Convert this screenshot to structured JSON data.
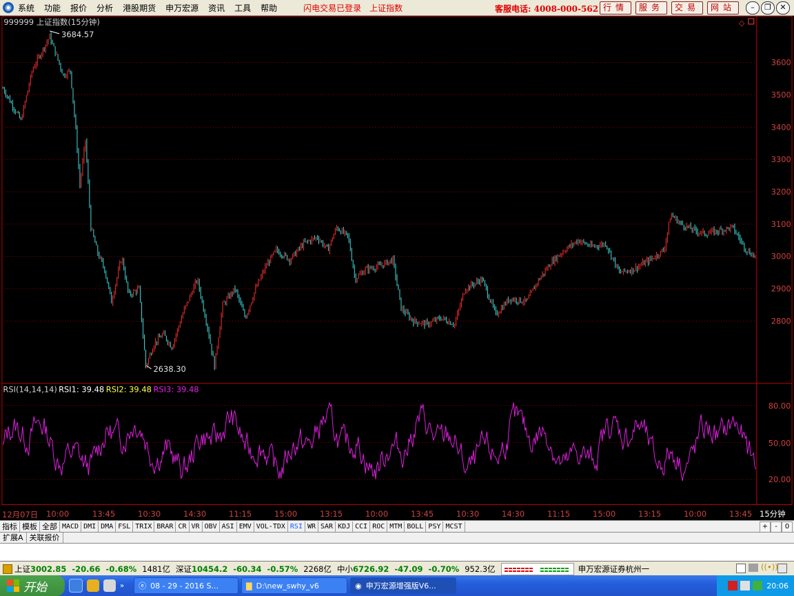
{
  "menu": {
    "items": [
      "系统",
      "功能",
      "报价",
      "分析",
      "港股期货",
      "申万宏源",
      "资讯",
      "工具",
      "帮助"
    ],
    "notice1": "闪电交易已登录",
    "notice2": "上证指数",
    "hotline": "客服电话: 4008-000-562",
    "quick": [
      "行情",
      "服务",
      "交易",
      "网站"
    ]
  },
  "price_chart": {
    "title": "999999 上证指数(15分钟)",
    "high_label": "3684.57",
    "low_label": "2638.30",
    "y_ticks": [
      3600,
      3500,
      3400,
      3300,
      3200,
      3100,
      3000,
      2900,
      2800
    ],
    "y_range": [
      2618,
      3706
    ]
  },
  "rsi": {
    "label": "RSI(14,14,14)",
    "rsi1": "RSI1: 39.48",
    "rsi2": "RSI2: 39.48",
    "rsi3": "RSI3: 39.48",
    "y_ticks": [
      "80.00",
      "50.00",
      "20.00"
    ],
    "color": "#e020e0"
  },
  "x_axis": {
    "ticks": [
      "12月07日",
      "10:00",
      "13:45",
      "10:30",
      "14:30",
      "11:15",
      "15:00",
      "13:15",
      "10:00",
      "13:45",
      "10:30",
      "14:30",
      "11:15",
      "15:00",
      "13:15",
      "10:00",
      "13:45"
    ],
    "period": "15分钟"
  },
  "indicator_tabs": [
    "指标",
    "模板",
    "全部",
    "MACD",
    "DMI",
    "DMA",
    "FSL",
    "TRIX",
    "BRAR",
    "CR",
    "VR",
    "OBV",
    "ASI",
    "EMV",
    "VOL-TDX",
    "RSI",
    "WR",
    "SAR",
    "KDJ",
    "CCI",
    "ROC",
    "MTM",
    "BOLL",
    "PSY",
    "MCST"
  ],
  "selected_tab": "RSI",
  "bottom_tabs": [
    "扩展A",
    "关联报价"
  ],
  "status": {
    "sh_name": "上证",
    "sh_val": "3002.85",
    "sh_chg": "-20.66",
    "sh_pct": "-0.68%",
    "sh_amt": "1481亿",
    "sz_name": "深证",
    "sz_val": "10454.2",
    "sz_chg": "-60.34",
    "sz_pct": "-0.57%",
    "sz_amt": "2268亿",
    "zx_name": "中小",
    "zx_val": "6726.92",
    "zx_chg": "-47.09",
    "zx_pct": "-0.70%",
    "zx_amt": "952.3亿",
    "broker": "申万宏源证券杭州一"
  },
  "taskbar": {
    "start": "开始",
    "tasks": [
      "08 - 29 - 2016 S...",
      "D:\\new_swhy_v6",
      "申万宏源增强版V6..."
    ],
    "clock": "20:06"
  },
  "colors": {
    "up": "#ff3030",
    "down": "#40e0e0",
    "grid": "#a00000",
    "axis": "#d04040"
  }
}
